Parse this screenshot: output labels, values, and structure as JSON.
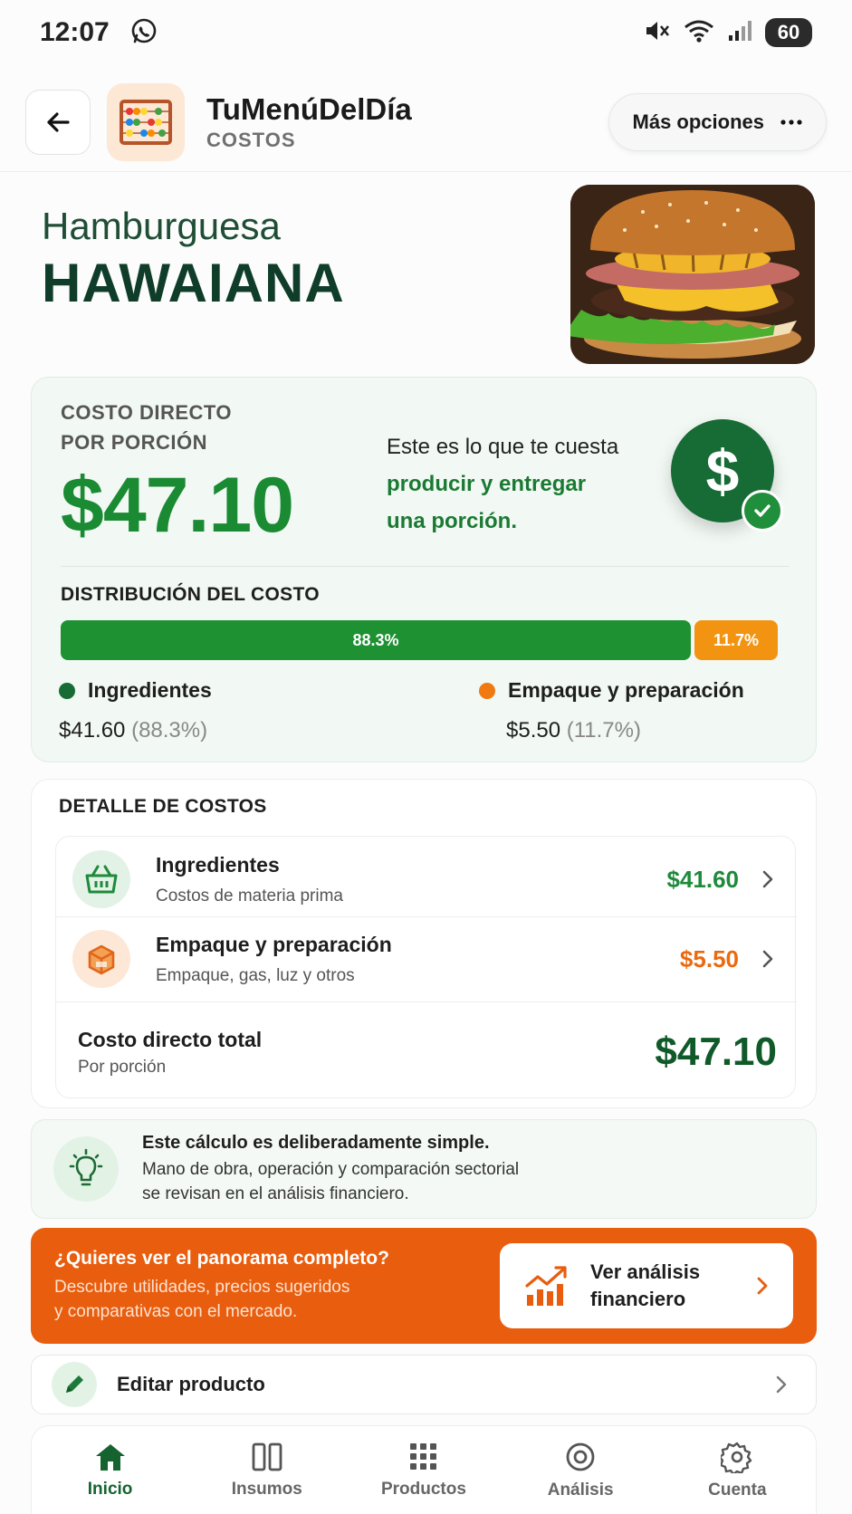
{
  "status_bar": {
    "time": "12:07",
    "battery": "60"
  },
  "header": {
    "app_name": "TuMenúDelDía",
    "section": "COSTOS",
    "more_label": "Más opciones"
  },
  "product": {
    "subtitle": "Hamburguesa",
    "title": "HAWAIANA"
  },
  "cost_summary": {
    "label_line1": "COSTO DIRECTO",
    "label_line2": "POR PORCIÓN",
    "value": "$47.10",
    "desc_plain": "Este es lo que te cuesta",
    "desc_highlight_line1": "producir y entregar",
    "desc_highlight_line2": "una porción.",
    "dollar_symbol": "$",
    "distribution_title": "DISTRIBUCIÓN DEL COSTO",
    "bar": {
      "ingredients_fraction": 0.883,
      "ingredients_label": "88.3%",
      "packaging_fraction": 0.117,
      "packaging_label": "11.7%"
    },
    "legend": [
      {
        "name": "Ingredientes",
        "amount": "$41.60",
        "pct": "(88.3%)",
        "color": "#176b35"
      },
      {
        "name": "Empaque y preparación",
        "amount": "$5.50",
        "pct": "(11.7%)",
        "color": "#f07a12"
      }
    ]
  },
  "detail": {
    "title": "DETALLE DE COSTOS",
    "rows": [
      {
        "title": "Ingredientes",
        "sub": "Costos de materia prima",
        "amount": "$41.60",
        "icon": "basket-icon",
        "color": "#1e8a3a"
      },
      {
        "title": "Empaque y preparación",
        "sub": "Empaque, gas, luz y otros",
        "amount": "$5.50",
        "icon": "box-icon",
        "color": "#ea6a10"
      }
    ],
    "total_title": "Costo directo total",
    "total_sub": "Por porción",
    "total_amount": "$47.10"
  },
  "note": {
    "title": "Este cálculo es deliberadamente simple.",
    "line1": "Mano de obra, operación y comparación sectorial",
    "line2": "se revisan en el análisis financiero."
  },
  "cta": {
    "title": "¿Quieres ver el panorama completo?",
    "line1": "Descubre utilidades, precios sugeridos",
    "line2": "y comparativas con el mercado.",
    "button_line1": "Ver análisis",
    "button_line2": "financiero"
  },
  "edit": {
    "label": "Editar producto"
  },
  "nav": [
    {
      "label": "Inicio",
      "icon": "home-icon",
      "active": true
    },
    {
      "label": "Insumos",
      "icon": "columns-icon",
      "active": false
    },
    {
      "label": "Productos",
      "icon": "grid-icon",
      "active": false
    },
    {
      "label": "Análisis",
      "icon": "target-icon",
      "active": false
    },
    {
      "label": "Cuenta",
      "icon": "gear-icon",
      "active": false
    }
  ],
  "colors": {
    "primary_green": "#176b35",
    "accent_green": "#1e9133",
    "accent_orange": "#e85d0e",
    "bar_orange": "#f29411"
  }
}
